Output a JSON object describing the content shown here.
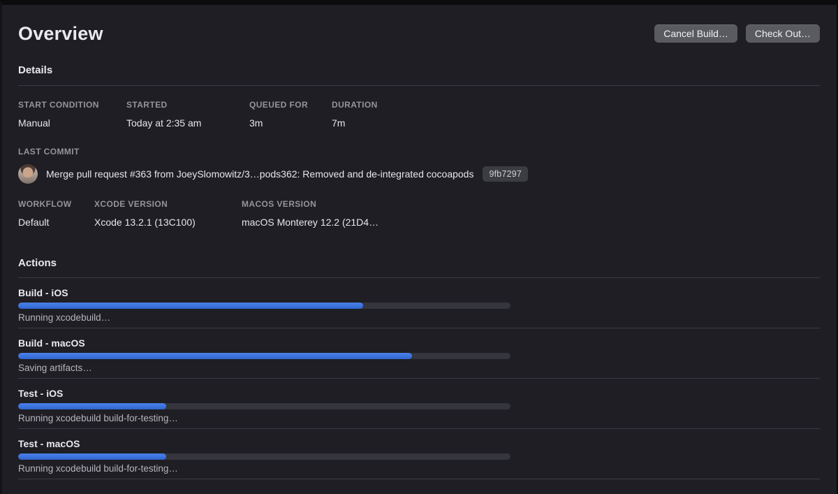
{
  "page": {
    "title": "Overview"
  },
  "toolbar": {
    "cancel_build_label": "Cancel Build…",
    "check_out_label": "Check Out…"
  },
  "details": {
    "heading": "Details",
    "row1": [
      {
        "label": "START CONDITION",
        "value": "Manual"
      },
      {
        "label": "STARTED",
        "value": "Today at 2:35 am"
      },
      {
        "label": "QUEUED FOR",
        "value": "3m"
      },
      {
        "label": "DURATION",
        "value": "7m"
      }
    ],
    "last_commit": {
      "label": "LAST COMMIT",
      "avatar_icon": "commit-author-photo",
      "message": "Merge pull request #363 from JoeySlomowitz/3…pods362: Removed and de-integrated cocoapods",
      "hash": "9fb7297"
    },
    "row2": [
      {
        "label": "WORKFLOW",
        "value": "Default"
      },
      {
        "label": "XCODE VERSION",
        "value": "Xcode 13.2.1 (13C100)"
      },
      {
        "label": "MACOS VERSION",
        "value": "macOS Monterey 12.2 (21D4…"
      }
    ]
  },
  "actions": {
    "heading": "Actions",
    "items": [
      {
        "title": "Build - iOS",
        "status": "Running xcodebuild…",
        "progress_percent": 70
      },
      {
        "title": "Build - macOS",
        "status": "Saving artifacts…",
        "progress_percent": 80
      },
      {
        "title": "Test - iOS",
        "status": "Running xcodebuild build-for-testing…",
        "progress_percent": 30
      },
      {
        "title": "Test - macOS",
        "status": "Running xcodebuild build-for-testing…",
        "progress_percent": 30
      }
    ]
  },
  "colors": {
    "background": "#1e1e24",
    "accent_progress_blue": "#3a72de",
    "progress_track": "#35353d",
    "button_gray": "#5a5a61",
    "divider": "#3b3b44",
    "label_gray": "#94949b",
    "badge_gray": "#3c3c43"
  }
}
